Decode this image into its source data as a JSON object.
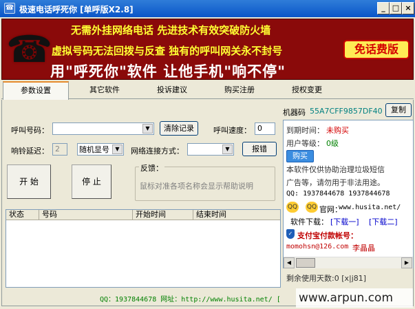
{
  "window": {
    "title": "极速电话呼死你 [单呼版X2.8]",
    "icon": "app-icon",
    "min": "_",
    "max": "□",
    "close": "×"
  },
  "banner": {
    "line1": "无需外挂网络电话 先进技术有效突破防火墙",
    "line2": "虚拟号码无法回拨与反查 独有的呼叫网关永不封号",
    "line3": "用\"呼死你\"软件 让他手机\"响不停\"",
    "badge": "免话费版",
    "phone_icon": "☎"
  },
  "tabs": [
    {
      "label": "参数设置"
    },
    {
      "label": "其它软件"
    },
    {
      "label": "投诉建议"
    },
    {
      "label": "购买注册"
    },
    {
      "label": "授权变更"
    }
  ],
  "machine": {
    "label": "机器码",
    "code": "55A7CFF9857DF40",
    "copy": "复制"
  },
  "call": {
    "number_label": "呼叫号码：",
    "number_value": "",
    "clear_btn": "清除记录",
    "speed_label": "呼叫速度：",
    "speed_value": "0",
    "delay_label": "响铃延迟：",
    "delay_value": "2",
    "display_value": "随机显号",
    "net_label": "网络连接方式：",
    "net_value": "",
    "report_btn": "报错",
    "start_btn": "开 始",
    "stop_btn": "停 止",
    "feedback_label": "反馈：",
    "feedback_text": "鼠标对准各项名称会显示帮助说明"
  },
  "table": {
    "headers": [
      "状态",
      "号码",
      "开始时间",
      "结束时间"
    ]
  },
  "info": {
    "expire_label": "到期时间：",
    "expire_value": "未购买",
    "level_label": "用户等级：",
    "level_value": "0级",
    "buy_btn": "购买",
    "notice1": "本软件仅供协助治理垃圾短信",
    "notice2": "广告等，请勿用于非法用途。",
    "qq_line": "QQ: 1937844678  1937844678",
    "site_label": "官网：",
    "site": "www.husita.net/",
    "download_label": "软件下载：",
    "download1": "[下载一]",
    "download2": "[下载二]",
    "alipay_label": "支付宝付款帐号：",
    "alipay_email": "momohsn@126.com",
    "alipay_name": "李晶晶"
  },
  "remain": "剩余使用天数:0 [x|j81]",
  "status": {
    "text": "QQ：1937844678  网址：http://www.husita.net/  [",
    "watermark": "www.arpun.com"
  },
  "colors": {
    "title_bar": "#0a55c8",
    "banner_bg": "#8a0a0a",
    "banner_yellow": "#ffff33",
    "machine_code": "#008080",
    "link": "#0000cc",
    "status_green": "#008000"
  }
}
